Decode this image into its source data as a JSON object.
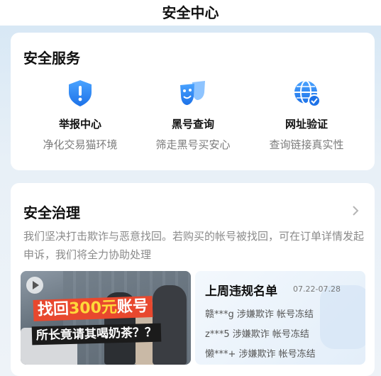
{
  "header": {
    "title": "安全中心"
  },
  "services": {
    "title": "安全服务",
    "items": [
      {
        "icon": "shield-exclamation-icon",
        "name": "举报中心",
        "desc": "净化交易猫环境"
      },
      {
        "icon": "masks-icon",
        "name": "黑号查询",
        "desc": "筛走黑号买安心"
      },
      {
        "icon": "globe-check-icon",
        "name": "网址验证",
        "desc": "查询链接真实性"
      }
    ]
  },
  "governance": {
    "title": "安全治理",
    "description": "我们坚决打击欺诈与恶意找回。若购买的帐号被找回，可在订单详情发起申诉，我们将全力协助处理",
    "media": {
      "line1_prefix": "找回",
      "line1_highlight": "300元",
      "line1_suffix": "账号",
      "line2": "所长竟请其喝奶茶？？"
    },
    "violations": {
      "title": "上周违规名单",
      "date_range": "07.22-07.28",
      "rows": [
        "赣***g 涉嫌欺诈 帐号冻结",
        "z***5 涉嫌欺诈 帐号冻结",
        "懒***+ 涉嫌欺诈 帐号冻结"
      ]
    }
  },
  "colors": {
    "accent_blue": "#2a8cf0",
    "muted_text": "#7b7b7b"
  }
}
